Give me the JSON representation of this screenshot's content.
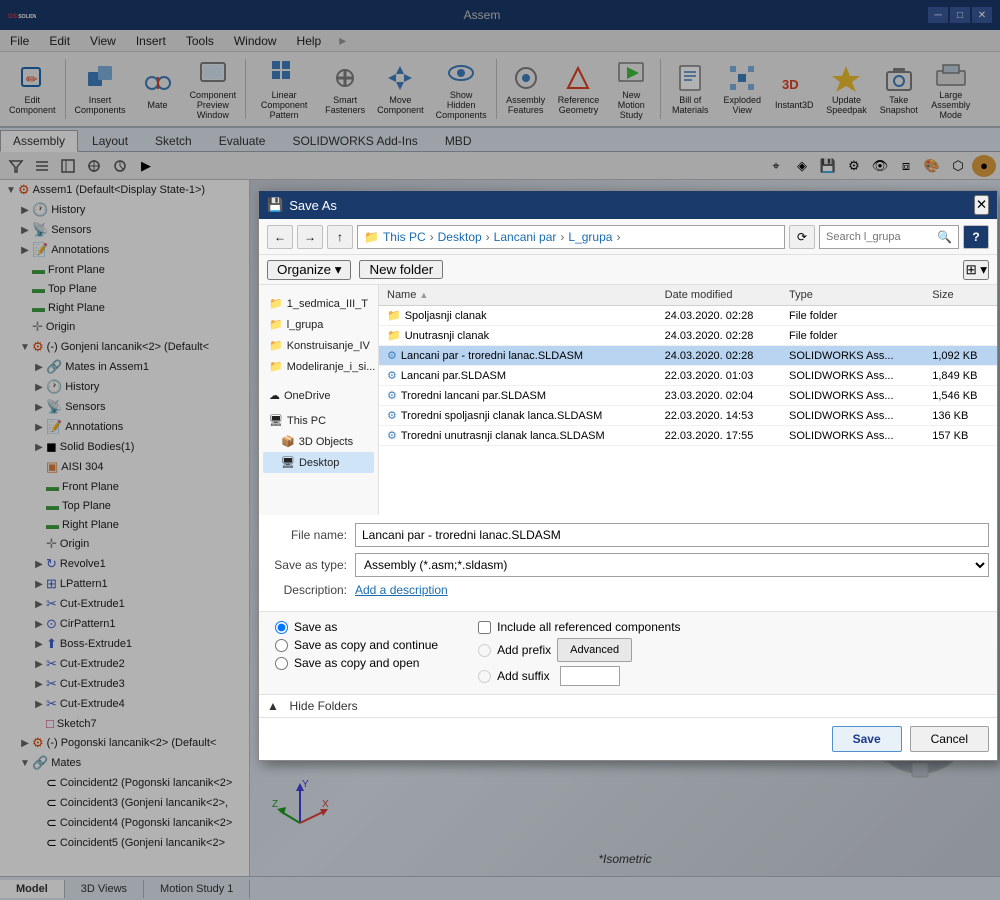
{
  "app": {
    "title": "Assem",
    "logo_alt": "SOLIDWORKS"
  },
  "menubar": {
    "items": [
      "File",
      "Edit",
      "View",
      "Insert",
      "Tools",
      "Window",
      "Help"
    ]
  },
  "toolbar": {
    "buttons": [
      {
        "id": "edit-component",
        "label": "Edit\nComponent",
        "icon": "✏️"
      },
      {
        "id": "insert-components",
        "label": "Insert\nComponents",
        "icon": "📦"
      },
      {
        "id": "mate",
        "label": "Mate",
        "icon": "🔗"
      },
      {
        "id": "component-preview",
        "label": "Component\nPreview\nWindow",
        "icon": "🖼"
      },
      {
        "id": "linear-pattern",
        "label": "Linear Component\nPattern",
        "icon": "⊞"
      },
      {
        "id": "smart-fasteners",
        "label": "Smart\nFasteners",
        "icon": "🔩"
      },
      {
        "id": "move-component",
        "label": "Move\nComponent",
        "icon": "↔"
      },
      {
        "id": "show-hidden",
        "label": "Show\nHidden\nComponents",
        "icon": "👁"
      },
      {
        "id": "assembly-features",
        "label": "Assembly\nFeatures",
        "icon": "⚙"
      },
      {
        "id": "reference-geometry",
        "label": "Reference\nGeometry",
        "icon": "📐"
      },
      {
        "id": "new-motion-study",
        "label": "New\nMotion\nStudy",
        "icon": "🎬"
      },
      {
        "id": "bill-of-materials",
        "label": "Bill of\nMaterials",
        "icon": "📋"
      },
      {
        "id": "exploded-view",
        "label": "Exploded\nView",
        "icon": "💥"
      },
      {
        "id": "instant3d",
        "label": "Instant3D",
        "icon": "3D"
      },
      {
        "id": "update-speedpak",
        "label": "Update\nSpeedpak",
        "icon": "⚡"
      },
      {
        "id": "take-snapshot",
        "label": "Take\nSnapshot",
        "icon": "📷"
      },
      {
        "id": "large-assembly",
        "label": "Large\nAssembly\nMode",
        "icon": "🏗"
      }
    ]
  },
  "tabs": {
    "items": [
      "Assembly",
      "Layout",
      "Sketch",
      "Evaluate",
      "SOLIDWORKS Add-Ins",
      "MBD"
    ],
    "active": "Assembly"
  },
  "feature_tree": {
    "root": "Assem1 (Default<Display State-1>)",
    "items": [
      {
        "id": "history",
        "label": "History",
        "indent": 1,
        "icon": "🕐",
        "expand": "▶"
      },
      {
        "id": "sensors",
        "label": "Sensors",
        "indent": 1,
        "icon": "📡",
        "expand": "▶"
      },
      {
        "id": "annotations",
        "label": "Annotations",
        "indent": 1,
        "icon": "📝",
        "expand": "▶"
      },
      {
        "id": "front-plane",
        "label": "Front Plane",
        "indent": 1,
        "icon": "▬",
        "expand": ""
      },
      {
        "id": "top-plane",
        "label": "Top Plane",
        "indent": 1,
        "icon": "▬",
        "expand": ""
      },
      {
        "id": "right-plane",
        "label": "Right Plane",
        "indent": 1,
        "icon": "▬",
        "expand": ""
      },
      {
        "id": "origin",
        "label": "Origin",
        "indent": 1,
        "icon": "✛",
        "expand": ""
      },
      {
        "id": "gonjeni",
        "label": "(-) Gonjeni lancanik<2> (Default<",
        "indent": 1,
        "icon": "⚙",
        "expand": "▼",
        "expanded": true
      },
      {
        "id": "mates-in-assem",
        "label": "Mates in Assem1",
        "indent": 2,
        "icon": "🔗",
        "expand": "▶"
      },
      {
        "id": "history2",
        "label": "History",
        "indent": 2,
        "icon": "🕐",
        "expand": "▶"
      },
      {
        "id": "sensors2",
        "label": "Sensors",
        "indent": 2,
        "icon": "📡",
        "expand": "▶"
      },
      {
        "id": "annotations2",
        "label": "Annotations",
        "indent": 2,
        "icon": "📝",
        "expand": "▶"
      },
      {
        "id": "solid-bodies",
        "label": "Solid Bodies(1)",
        "indent": 2,
        "icon": "◼",
        "expand": "▶"
      },
      {
        "id": "aisi304",
        "label": "AISI 304",
        "indent": 2,
        "icon": "📦",
        "expand": ""
      },
      {
        "id": "front-plane2",
        "label": "Front Plane",
        "indent": 2,
        "icon": "▬",
        "expand": ""
      },
      {
        "id": "top-plane2",
        "label": "Top Plane",
        "indent": 2,
        "icon": "▬",
        "expand": ""
      },
      {
        "id": "right-plane2",
        "label": "Right Plane",
        "indent": 2,
        "icon": "▬",
        "expand": ""
      },
      {
        "id": "origin2",
        "label": "Origin",
        "indent": 2,
        "icon": "✛",
        "expand": ""
      },
      {
        "id": "revolve1",
        "label": "Revolve1",
        "indent": 2,
        "icon": "↻",
        "expand": "▶"
      },
      {
        "id": "lpattern1",
        "label": "LPattern1",
        "indent": 2,
        "icon": "⊞",
        "expand": "▶"
      },
      {
        "id": "cut-extrude1",
        "label": "Cut-Extrude1",
        "indent": 2,
        "icon": "✂",
        "expand": "▶"
      },
      {
        "id": "cirpattern1",
        "label": "CirPattern1",
        "indent": 2,
        "icon": "⊙",
        "expand": "▶"
      },
      {
        "id": "boss-extrude1",
        "label": "Boss-Extrude1",
        "indent": 2,
        "icon": "⬆",
        "expand": "▶"
      },
      {
        "id": "cut-extrude2",
        "label": "Cut-Extrude2",
        "indent": 2,
        "icon": "✂",
        "expand": "▶"
      },
      {
        "id": "cut-extrude3",
        "label": "Cut-Extrude3",
        "indent": 2,
        "icon": "✂",
        "expand": "▶"
      },
      {
        "id": "cut-extrude4",
        "label": "Cut-Extrude4",
        "indent": 2,
        "icon": "✂",
        "expand": "▶"
      },
      {
        "id": "sketch7",
        "label": "Sketch7",
        "indent": 2,
        "icon": "✏",
        "expand": ""
      },
      {
        "id": "pogonski",
        "label": "(-) Pogonski lancanik<2> (Default<",
        "indent": 1,
        "icon": "⚙",
        "expand": "▶"
      },
      {
        "id": "mates",
        "label": "Mates",
        "indent": 1,
        "icon": "🔗",
        "expand": "▼",
        "expanded": true
      },
      {
        "id": "coincident2",
        "label": "Coincident2 (Pogonski lancanik<2>",
        "indent": 2,
        "icon": "⊂",
        "expand": ""
      },
      {
        "id": "coincident3",
        "label": "Coincident3 (Gonjeni lancanik<2>,",
        "indent": 2,
        "icon": "⊂",
        "expand": ""
      },
      {
        "id": "coincident4",
        "label": "Coincident4 (Pogonski lancanik<2>",
        "indent": 2,
        "icon": "⊂",
        "expand": ""
      },
      {
        "id": "coincident5",
        "label": "Coincident5 (Gonjeni lancanik<2>",
        "indent": 2,
        "icon": "⊂",
        "expand": ""
      }
    ]
  },
  "dialog": {
    "title": "Save As",
    "title_icon": "💾",
    "nav": {
      "back_label": "←",
      "forward_label": "→",
      "up_label": "↑",
      "path_parts": [
        "This PC",
        ">",
        "Desktop",
        ">",
        "Lancani par",
        ">",
        "L_grupa",
        ">"
      ],
      "search_placeholder": "Search l_grupa",
      "refresh_label": "⟳",
      "view_label": "⊞"
    },
    "toolbar": {
      "organize_label": "Organize ▾",
      "new_folder_label": "New folder"
    },
    "columns": [
      "Name",
      "Date modified",
      "Type",
      "Size"
    ],
    "sidebar_folders": [
      {
        "id": "sedmica",
        "label": "1_sedmica_III_T",
        "icon": "📁"
      },
      {
        "id": "l_grupa",
        "label": "l_grupa",
        "icon": "📁"
      },
      {
        "id": "konstruisanje",
        "label": "Konstruisanje_IV",
        "icon": "📁"
      },
      {
        "id": "modeliranje",
        "label": "Modeliranje_i_si...",
        "icon": "📁"
      },
      {
        "id": "onedrive",
        "label": "OneDrive",
        "icon": "☁"
      },
      {
        "id": "this-pc",
        "label": "This PC",
        "icon": "🖥"
      },
      {
        "id": "3d-objects",
        "label": "3D Objects",
        "icon": "📦"
      },
      {
        "id": "desktop",
        "label": "Desktop",
        "icon": "🖥"
      }
    ],
    "files": [
      {
        "id": "spoljasnji",
        "name": "Spoljasnji clanak",
        "date": "24.03.2020. 02:28",
        "type": "File folder",
        "size": "",
        "is_folder": true,
        "selected": false
      },
      {
        "id": "unutrasnji",
        "name": "Unutrasnji clanak",
        "date": "24.03.2020. 02:28",
        "type": "File folder",
        "size": "",
        "is_folder": true,
        "selected": false
      },
      {
        "id": "lancani-troredni",
        "name": "Lancani par - troredni lanac.SLDASM",
        "date": "24.03.2020. 02:28",
        "type": "SOLIDWORKS Ass...",
        "size": "1,092 KB",
        "is_folder": false,
        "selected": true
      },
      {
        "id": "lancani-par",
        "name": "Lancani par.SLDASM",
        "date": "22.03.2020. 01:03",
        "type": "SOLIDWORKS Ass...",
        "size": "1,849 KB",
        "is_folder": false,
        "selected": false
      },
      {
        "id": "troredni-lancani",
        "name": "Troredni lancani par.SLDASM",
        "date": "23.03.2020. 02:04",
        "type": "SOLIDWORKS Ass...",
        "size": "1,546 KB",
        "is_folder": false,
        "selected": false
      },
      {
        "id": "troredni-spoljasnji",
        "name": "Troredni spoljasnji clanak lanca.SLDASM",
        "date": "22.03.2020. 14:53",
        "type": "SOLIDWORKS Ass...",
        "size": "136 KB",
        "is_folder": false,
        "selected": false
      },
      {
        "id": "troredni-unutrasnji",
        "name": "Troredni unutrasnji clanak lanca.SLDASM",
        "date": "22.03.2020. 17:55",
        "type": "SOLIDWORKS Ass...",
        "size": "157 KB",
        "is_folder": false,
        "selected": false
      }
    ],
    "filename_label": "File name:",
    "filename_value": "Lancani par - troredni lanac.SLDASM",
    "saveas_type_label": "Save as type:",
    "saveas_type_value": "Assembly (*.asm;*.sldasm)",
    "description_label": "Description:",
    "description_link": "Add a description",
    "options": {
      "save_as_label": "Save as",
      "save_copy_continue_label": "Save as copy and continue",
      "save_copy_open_label": "Save as copy and open",
      "include_referenced_label": "Include all referenced components",
      "add_prefix_label": "Add prefix",
      "add_suffix_label": "Add suffix",
      "advanced_label": "Advanced"
    },
    "hide_folders_label": "▲  Hide Folders",
    "save_label": "Save",
    "cancel_label": "Cancel"
  },
  "viewport": {
    "label": "*Isometric",
    "axes": {
      "x_label": "X",
      "y_label": "Y",
      "z_label": "Z"
    }
  },
  "bottom_tabs": {
    "items": [
      "Model",
      "3D Views",
      "Motion Study 1"
    ],
    "active": "Model"
  }
}
